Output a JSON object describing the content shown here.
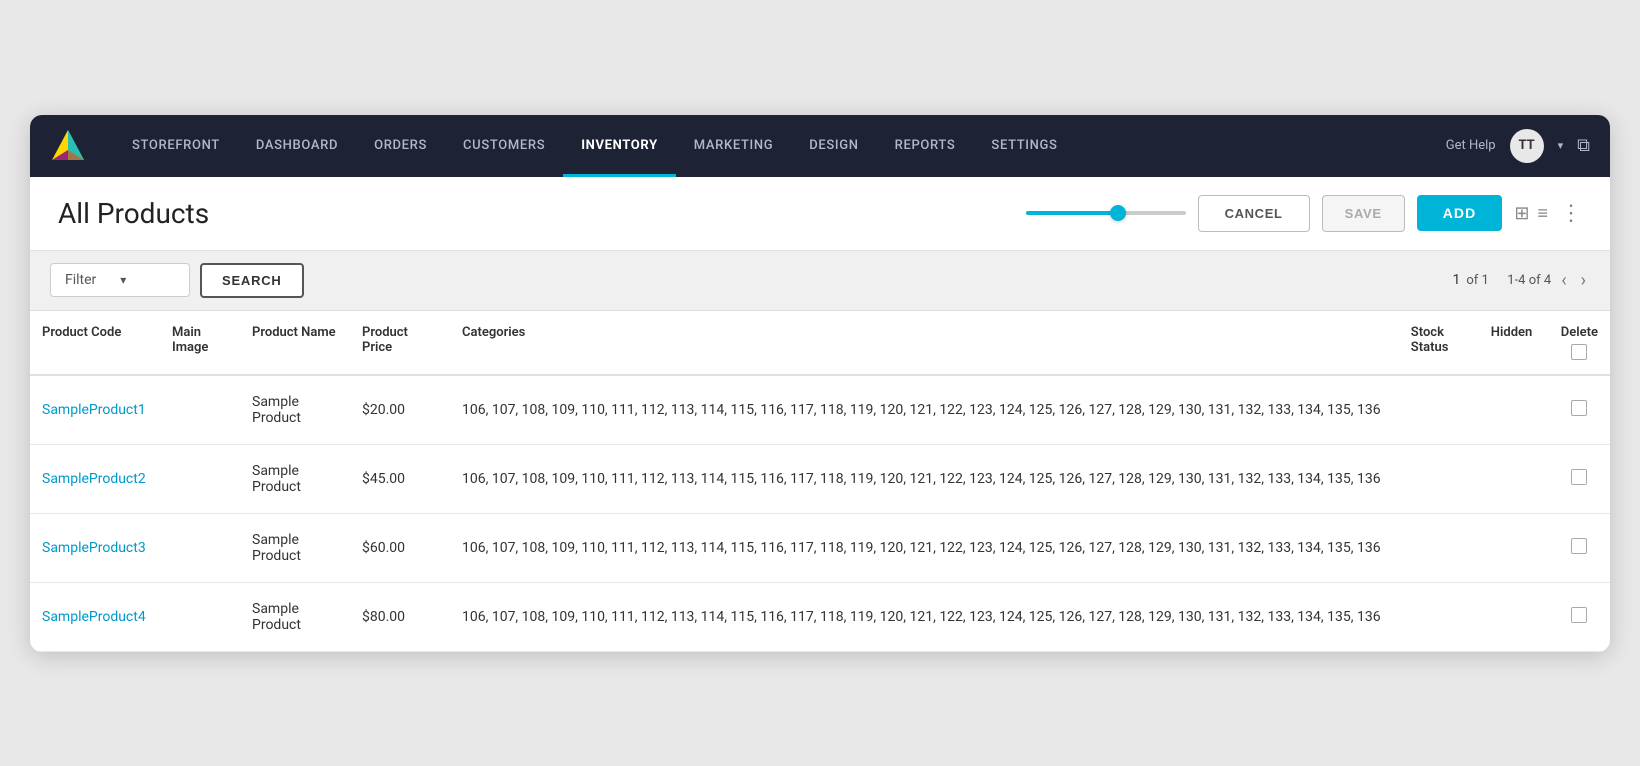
{
  "nav": {
    "items": [
      {
        "label": "STOREFRONT",
        "active": false
      },
      {
        "label": "DASHBOARD",
        "active": false
      },
      {
        "label": "ORDERS",
        "active": false
      },
      {
        "label": "CUSTOMERS",
        "active": false
      },
      {
        "label": "INVENTORY",
        "active": true
      },
      {
        "label": "MARKETING",
        "active": false
      },
      {
        "label": "DESIGN",
        "active": false
      },
      {
        "label": "REPORTS",
        "active": false
      },
      {
        "label": "SETTINGS",
        "active": false
      }
    ],
    "help_label": "Get Help",
    "avatar_initials": "TT",
    "external_icon": "⧉"
  },
  "header": {
    "title": "All Products",
    "cancel_label": "CANCEL",
    "save_label": "SAVE",
    "add_label": "ADD"
  },
  "toolbar": {
    "filter_label": "Filter",
    "search_label": "SEARCH",
    "pagination": {
      "current_page": "1",
      "of_label": "of 1",
      "range_label": "1-4 of 4"
    }
  },
  "table": {
    "columns": [
      {
        "key": "code",
        "label": "Product Code"
      },
      {
        "key": "image",
        "label": "Main Image"
      },
      {
        "key": "name",
        "label": "Product Name"
      },
      {
        "key": "price",
        "label": "Product Price"
      },
      {
        "key": "categories",
        "label": "Categories"
      },
      {
        "key": "stock",
        "label": "Stock Status"
      },
      {
        "key": "hidden",
        "label": "Hidden"
      },
      {
        "key": "delete",
        "label": "Delete"
      }
    ],
    "rows": [
      {
        "code": "SampleProduct1",
        "name": "Sample Product",
        "price": "$20.00",
        "categories": "106, 107, 108, 109, 110, 111, 112, 113, 114, 115, 116, 117, 118, 119, 120, 121, 122, 123, 124, 125, 126, 127, 128, 129, 130, 131, 132, 133, 134, 135, 136"
      },
      {
        "code": "SampleProduct2",
        "name": "Sample Product",
        "price": "$45.00",
        "categories": "106, 107, 108, 109, 110, 111, 112, 113, 114, 115, 116, 117, 118, 119, 120, 121, 122, 123, 124, 125, 126, 127, 128, 129, 130, 131, 132, 133, 134, 135, 136"
      },
      {
        "code": "SampleProduct3",
        "name": "Sample Product",
        "price": "$60.00",
        "categories": "106, 107, 108, 109, 110, 111, 112, 113, 114, 115, 116, 117, 118, 119, 120, 121, 122, 123, 124, 125, 126, 127, 128, 129, 130, 131, 132, 133, 134, 135, 136"
      },
      {
        "code": "SampleProduct4",
        "name": "Sample Product",
        "price": "$80.00",
        "categories": "106, 107, 108, 109, 110, 111, 112, 113, 114, 115, 116, 117, 118, 119, 120, 121, 122, 123, 124, 125, 126, 127, 128, 129, 130, 131, 132, 133, 134, 135, 136"
      }
    ]
  }
}
